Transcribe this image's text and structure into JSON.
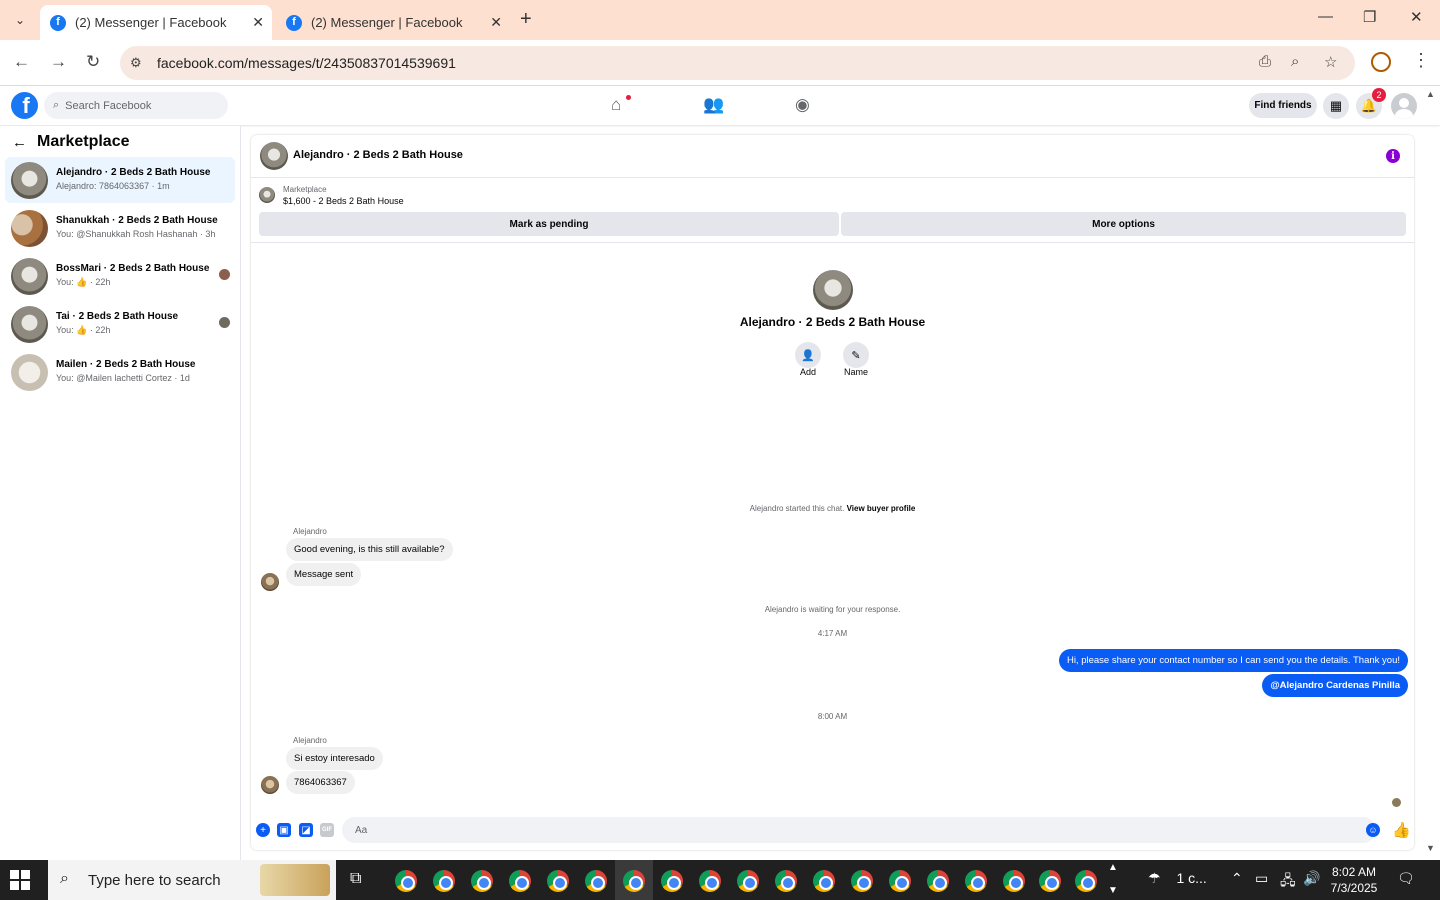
{
  "browser": {
    "tabs": [
      {
        "title": "(2) Messenger | Facebook",
        "active": true
      },
      {
        "title": "(2) Messenger | Facebook",
        "active": false
      }
    ],
    "url": "facebook.com/messages/t/24350837014539691"
  },
  "fb_header": {
    "search_placeholder": "Search Facebook",
    "find_friends_label": "Find friends",
    "notification_count": "2"
  },
  "sidebar": {
    "title": "Marketplace",
    "conversations": [
      {
        "name": "Alejandro · 2 Beds 2 Bath House",
        "snippet": "Alejandro: 7864063367 · 1m",
        "active": true
      },
      {
        "name": "Shanukkah · 2 Beds 2 Bath House",
        "snippet": "You: @Shanukkah Rosh Hashanah · 3h",
        "active": false
      },
      {
        "name": "BossMari · 2 Beds 2 Bath House",
        "snippet": "You: 👍 · 22h",
        "active": false
      },
      {
        "name": "Tai · 2 Beds 2 Bath House",
        "snippet": "You: 👍 · 22h",
        "active": false
      },
      {
        "name": "Mailen · 2 Beds 2 Bath House",
        "snippet": "You: @Mailen lachetti Cortez · 1d",
        "active": false
      }
    ]
  },
  "chat": {
    "title": "Alejandro · 2 Beds 2 Bath House",
    "listing": {
      "source": "Marketplace",
      "description": "$1,600 - 2 Beds 2 Bath House",
      "mark_pending_label": "Mark as pending",
      "more_options_label": "More options"
    },
    "profile": {
      "name": "Alejandro · 2 Beds 2 Bath House",
      "add_label": "Add",
      "name_label": "Name"
    },
    "started_text": "Alejandro started this chat.",
    "view_buyer_profile": "View buyer profile",
    "messages": {
      "sender1": "Alejandro",
      "m1": "Good evening, is this still available?",
      "m2": "Message sent",
      "waiting": "Alejandro is waiting for your response.",
      "time1": "4:17 AM",
      "m3": "Hi, please share your contact number so I can send you the details. Thank you!",
      "m4": "@Alejandro Cardenas Pinilla",
      "time2": "8:00 AM",
      "sender2": "Alejandro",
      "m5": "Si estoy interesado",
      "m6": "7864063367"
    },
    "composer_placeholder": "Aa"
  },
  "taskbar": {
    "search_placeholder": "Type here to search",
    "weather": "1 c...",
    "time": "8:02 AM",
    "date": "7/3/2025"
  },
  "colors": {
    "accent": "#0a5cf5",
    "fb_blue": "#1877f2",
    "tabbar": "#fde0d0",
    "info": "#8a00d4"
  }
}
